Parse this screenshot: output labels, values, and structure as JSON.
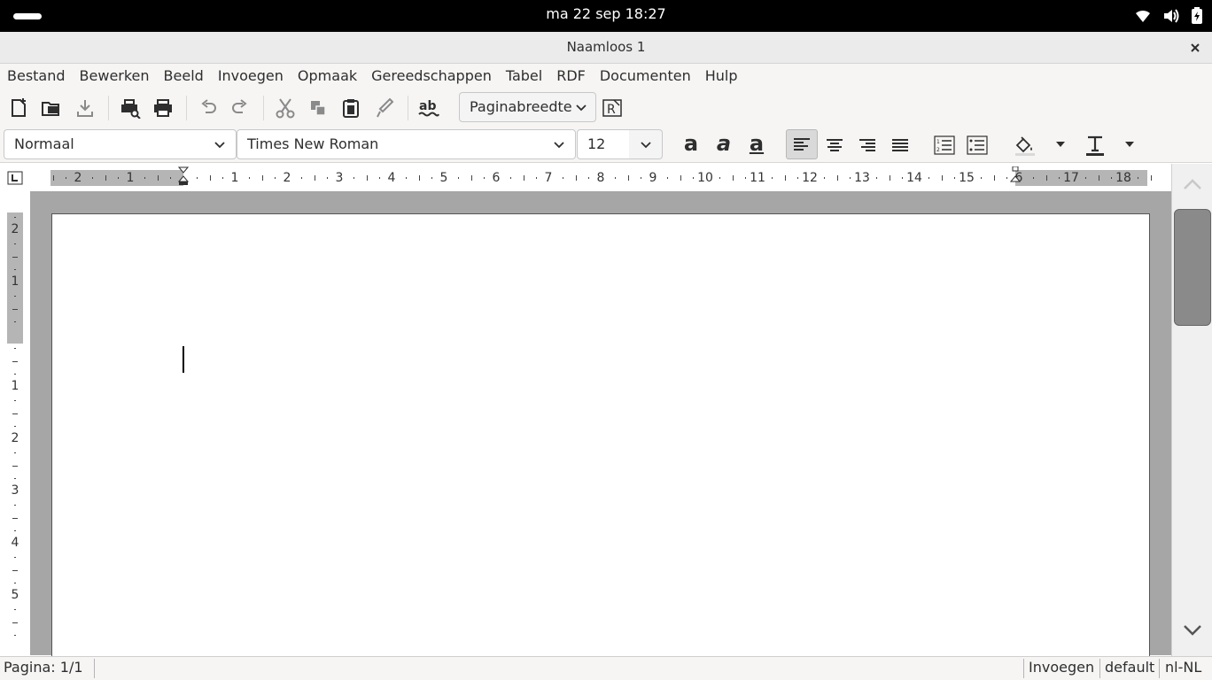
{
  "system": {
    "clock": "ma 22 sep 18:27",
    "tray_icons": [
      "wifi-icon",
      "volume-icon",
      "battery-icon"
    ]
  },
  "window": {
    "title": "Naamloos 1"
  },
  "menu": {
    "items": [
      "Bestand",
      "Bewerken",
      "Beeld",
      "Invoegen",
      "Opmaak",
      "Gereedschappen",
      "Tabel",
      "RDF",
      "Documenten",
      "Hulp"
    ]
  },
  "toolbar": {
    "zoom_value": "Paginabreedte"
  },
  "formatting": {
    "paragraph_style": "Normaal",
    "font_name": "Times New Roman",
    "font_size": "12",
    "bold_glyph": "a",
    "italic_glyph": "a",
    "underline_glyph": "a"
  },
  "ruler": {
    "horizontal_labels": [
      "2",
      "1",
      "1",
      "2",
      "3",
      "4",
      "5",
      "6",
      "7",
      "8",
      "9",
      "10",
      "11",
      "12",
      "13",
      "14",
      "15",
      "6",
      "17",
      "18"
    ],
    "vertical_labels": [
      "2",
      "1",
      "1",
      "2",
      "3",
      "4",
      "5"
    ]
  },
  "statusbar": {
    "page": "Pagina: 1/1",
    "mode": "Invoegen",
    "style": "default",
    "language": "nl-NL"
  }
}
